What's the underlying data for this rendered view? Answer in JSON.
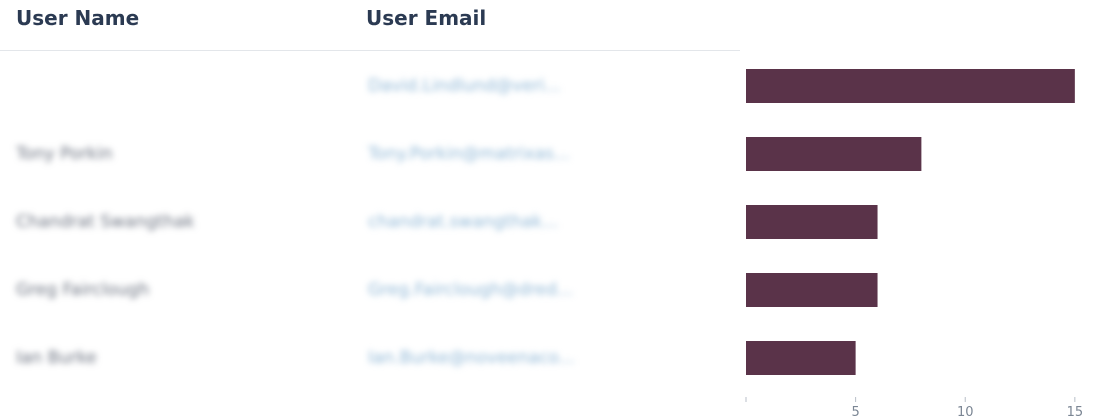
{
  "table": {
    "headers": {
      "name": "User Name",
      "email": "User Email"
    },
    "rows": [
      {
        "name": "",
        "email": "David.Lindlund@veri..."
      },
      {
        "name": "Tony Porkin",
        "email": "Tony.Porkin@matrixas..."
      },
      {
        "name": "Chandrat Swangthak",
        "email": "chandrat.swangthak..."
      },
      {
        "name": "Greg Fairclough",
        "email": "Greg.Fairclough@dred..."
      },
      {
        "name": "Ian Burke",
        "email": "Ian.Burke@noveenaco..."
      }
    ]
  },
  "chart_data": {
    "type": "bar",
    "orientation": "horizontal",
    "values": [
      15,
      8,
      6,
      6,
      5
    ],
    "xlim": [
      0,
      15.6
    ],
    "ticks": [
      "",
      "5",
      "10",
      "15"
    ],
    "tick_values": [
      0,
      5,
      10,
      15
    ],
    "color": "#5a3349"
  }
}
